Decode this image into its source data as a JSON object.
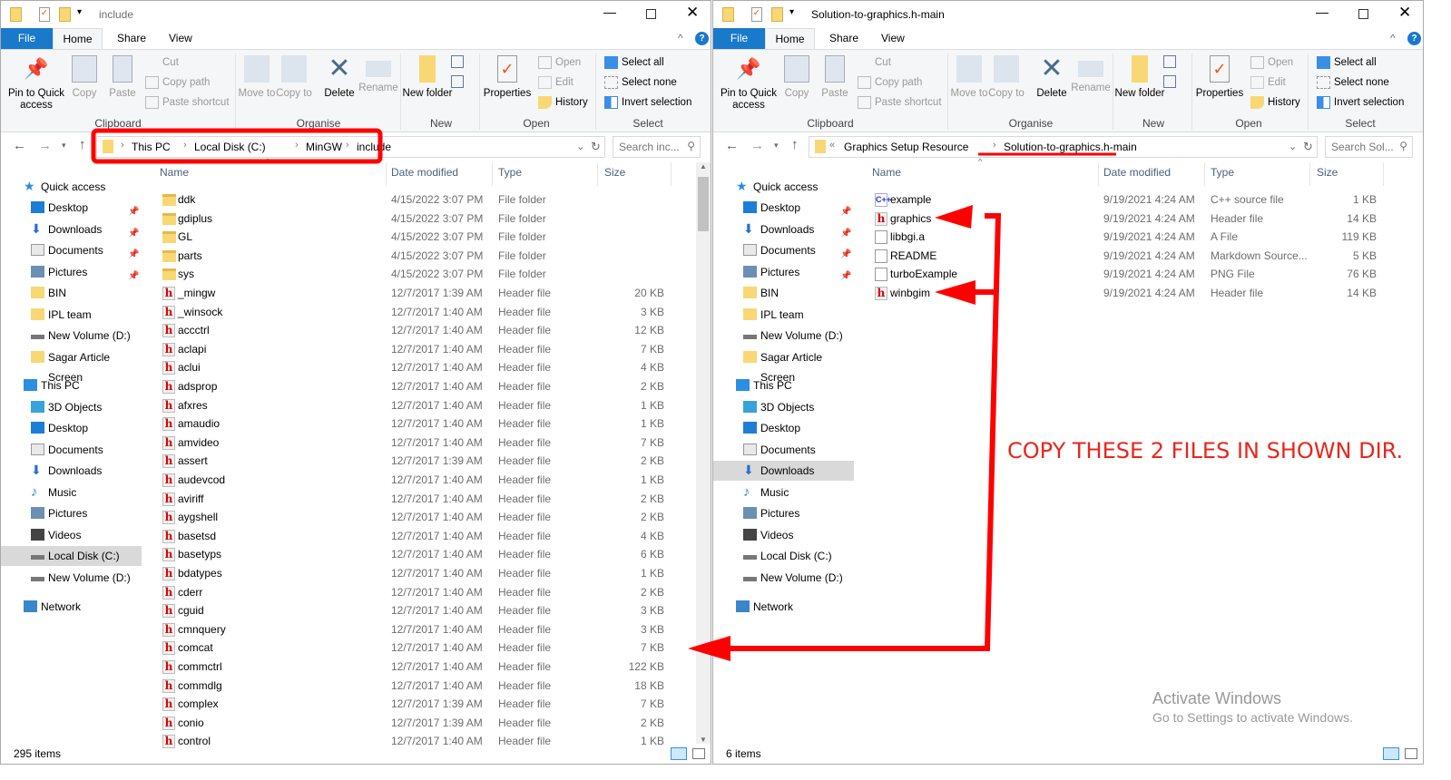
{
  "ribbon": {
    "tabs": {
      "file": "File",
      "home": "Home",
      "share": "Share",
      "view": "View"
    },
    "pin": "Pin to Quick access",
    "copy": "Copy",
    "paste": "Paste",
    "cut": "Cut",
    "copy_path": "Copy path",
    "paste_shortcut": "Paste shortcut",
    "clipboard": "Clipboard",
    "move_to": "Move to",
    "copy_to": "Copy to",
    "delete": "Delete",
    "rename": "Rename",
    "organise": "Organise",
    "new_folder": "New folder",
    "new": "New",
    "properties": "Properties",
    "open": "Open",
    "edit": "Edit",
    "history": "History",
    "open_group": "Open",
    "select_all": "Select all",
    "select_none": "Select none",
    "invert_selection": "Invert selection",
    "select": "Select"
  },
  "columns": {
    "name": "Name",
    "date": "Date modified",
    "type": "Type",
    "size": "Size"
  },
  "left": {
    "title": "include",
    "breadcrumb": [
      "This PC",
      "Local Disk (C:)",
      "MinGW",
      "include"
    ],
    "search_placeholder": "Search inc...",
    "status": "295 items",
    "nav": [
      {
        "label": "Quick access",
        "icon": "star",
        "top": true
      },
      {
        "label": "Desktop",
        "icon": "desktop",
        "pin": true
      },
      {
        "label": "Downloads",
        "icon": "download",
        "pin": true
      },
      {
        "label": "Documents",
        "icon": "document",
        "pin": true
      },
      {
        "label": "Pictures",
        "icon": "pictures",
        "pin": true
      },
      {
        "label": "BIN",
        "icon": "folder"
      },
      {
        "label": "IPL team",
        "icon": "folder"
      },
      {
        "label": "New Volume (D:)",
        "icon": "drive"
      },
      {
        "label": "Sagar Article Screen",
        "icon": "folder"
      },
      {
        "label": "This PC",
        "icon": "pc",
        "top": true
      },
      {
        "label": "3D Objects",
        "icon": "cube"
      },
      {
        "label": "Desktop",
        "icon": "desktop"
      },
      {
        "label": "Documents",
        "icon": "document"
      },
      {
        "label": "Downloads",
        "icon": "download"
      },
      {
        "label": "Music",
        "icon": "music"
      },
      {
        "label": "Pictures",
        "icon": "pictures"
      },
      {
        "label": "Videos",
        "icon": "videos"
      },
      {
        "label": "Local Disk (C:)",
        "icon": "drive",
        "selected": true
      },
      {
        "label": "New Volume (D:)",
        "icon": "drive"
      },
      {
        "label": "Network",
        "icon": "network",
        "top": true
      }
    ],
    "files": [
      {
        "name": "ddk",
        "date": "4/15/2022 3:07 PM",
        "type": "File folder",
        "size": "",
        "icon": "folder"
      },
      {
        "name": "gdiplus",
        "date": "4/15/2022 3:07 PM",
        "type": "File folder",
        "size": "",
        "icon": "folder"
      },
      {
        "name": "GL",
        "date": "4/15/2022 3:07 PM",
        "type": "File folder",
        "size": "",
        "icon": "folder"
      },
      {
        "name": "parts",
        "date": "4/15/2022 3:07 PM",
        "type": "File folder",
        "size": "",
        "icon": "folder"
      },
      {
        "name": "sys",
        "date": "4/15/2022 3:07 PM",
        "type": "File folder",
        "size": "",
        "icon": "folder"
      },
      {
        "name": "_mingw",
        "date": "12/7/2017 1:39 AM",
        "type": "Header file",
        "size": "20 KB",
        "icon": "h"
      },
      {
        "name": "_winsock",
        "date": "12/7/2017 1:40 AM",
        "type": "Header file",
        "size": "3 KB",
        "icon": "h"
      },
      {
        "name": "accctrl",
        "date": "12/7/2017 1:40 AM",
        "type": "Header file",
        "size": "12 KB",
        "icon": "h"
      },
      {
        "name": "aclapi",
        "date": "12/7/2017 1:40 AM",
        "type": "Header file",
        "size": "7 KB",
        "icon": "h"
      },
      {
        "name": "aclui",
        "date": "12/7/2017 1:40 AM",
        "type": "Header file",
        "size": "4 KB",
        "icon": "h"
      },
      {
        "name": "adsprop",
        "date": "12/7/2017 1:40 AM",
        "type": "Header file",
        "size": "2 KB",
        "icon": "h"
      },
      {
        "name": "afxres",
        "date": "12/7/2017 1:40 AM",
        "type": "Header file",
        "size": "1 KB",
        "icon": "h"
      },
      {
        "name": "amaudio",
        "date": "12/7/2017 1:40 AM",
        "type": "Header file",
        "size": "1 KB",
        "icon": "h"
      },
      {
        "name": "amvideo",
        "date": "12/7/2017 1:40 AM",
        "type": "Header file",
        "size": "7 KB",
        "icon": "h"
      },
      {
        "name": "assert",
        "date": "12/7/2017 1:39 AM",
        "type": "Header file",
        "size": "2 KB",
        "icon": "h"
      },
      {
        "name": "audevcod",
        "date": "12/7/2017 1:40 AM",
        "type": "Header file",
        "size": "1 KB",
        "icon": "h"
      },
      {
        "name": "aviriff",
        "date": "12/7/2017 1:40 AM",
        "type": "Header file",
        "size": "2 KB",
        "icon": "h"
      },
      {
        "name": "aygshell",
        "date": "12/7/2017 1:40 AM",
        "type": "Header file",
        "size": "2 KB",
        "icon": "h"
      },
      {
        "name": "basetsd",
        "date": "12/7/2017 1:40 AM",
        "type": "Header file",
        "size": "4 KB",
        "icon": "h"
      },
      {
        "name": "basetyps",
        "date": "12/7/2017 1:40 AM",
        "type": "Header file",
        "size": "6 KB",
        "icon": "h"
      },
      {
        "name": "bdatypes",
        "date": "12/7/2017 1:40 AM",
        "type": "Header file",
        "size": "1 KB",
        "icon": "h"
      },
      {
        "name": "cderr",
        "date": "12/7/2017 1:40 AM",
        "type": "Header file",
        "size": "2 KB",
        "icon": "h"
      },
      {
        "name": "cguid",
        "date": "12/7/2017 1:40 AM",
        "type": "Header file",
        "size": "3 KB",
        "icon": "h"
      },
      {
        "name": "cmnquery",
        "date": "12/7/2017 1:40 AM",
        "type": "Header file",
        "size": "3 KB",
        "icon": "h"
      },
      {
        "name": "comcat",
        "date": "12/7/2017 1:40 AM",
        "type": "Header file",
        "size": "7 KB",
        "icon": "h"
      },
      {
        "name": "commctrl",
        "date": "12/7/2017 1:40 AM",
        "type": "Header file",
        "size": "122 KB",
        "icon": "h"
      },
      {
        "name": "commdlg",
        "date": "12/7/2017 1:40 AM",
        "type": "Header file",
        "size": "18 KB",
        "icon": "h"
      },
      {
        "name": "complex",
        "date": "12/7/2017 1:39 AM",
        "type": "Header file",
        "size": "7 KB",
        "icon": "h"
      },
      {
        "name": "conio",
        "date": "12/7/2017 1:39 AM",
        "type": "Header file",
        "size": "2 KB",
        "icon": "h"
      },
      {
        "name": "control",
        "date": "12/7/2017 1:40 AM",
        "type": "Header file",
        "size": "1 KB",
        "icon": "h"
      }
    ]
  },
  "right": {
    "title": "Solution-to-graphics.h-main",
    "breadcrumb": [
      "Graphics Setup Resource",
      "Solution-to-graphics.h-main"
    ],
    "search_placeholder": "Search Sol...",
    "status": "6 items",
    "nav": [
      {
        "label": "Quick access",
        "icon": "star",
        "top": true
      },
      {
        "label": "Desktop",
        "icon": "desktop",
        "pin": true
      },
      {
        "label": "Downloads",
        "icon": "download",
        "pin": true
      },
      {
        "label": "Documents",
        "icon": "document",
        "pin": true
      },
      {
        "label": "Pictures",
        "icon": "pictures",
        "pin": true
      },
      {
        "label": "BIN",
        "icon": "folder"
      },
      {
        "label": "IPL team",
        "icon": "folder"
      },
      {
        "label": "New Volume (D:)",
        "icon": "drive"
      },
      {
        "label": "Sagar Article Screen",
        "icon": "folder"
      },
      {
        "label": "This PC",
        "icon": "pc",
        "top": true
      },
      {
        "label": "3D Objects",
        "icon": "cube"
      },
      {
        "label": "Desktop",
        "icon": "desktop"
      },
      {
        "label": "Documents",
        "icon": "document"
      },
      {
        "label": "Downloads",
        "icon": "download",
        "selected": true
      },
      {
        "label": "Music",
        "icon": "music"
      },
      {
        "label": "Pictures",
        "icon": "pictures"
      },
      {
        "label": "Videos",
        "icon": "videos"
      },
      {
        "label": "Local Disk (C:)",
        "icon": "drive"
      },
      {
        "label": "New Volume (D:)",
        "icon": "drive"
      },
      {
        "label": "Network",
        "icon": "network",
        "top": true
      }
    ],
    "files": [
      {
        "name": "example",
        "date": "9/19/2021 4:24 AM",
        "type": "C++ source file",
        "size": "1 KB",
        "icon": "cpp"
      },
      {
        "name": "graphics",
        "date": "9/19/2021 4:24 AM",
        "type": "Header file",
        "size": "14 KB",
        "icon": "h"
      },
      {
        "name": "libbgi.a",
        "date": "9/19/2021 4:24 AM",
        "type": "A File",
        "size": "119 KB",
        "icon": "plain"
      },
      {
        "name": "README",
        "date": "9/19/2021 4:24 AM",
        "type": "Markdown Source...",
        "size": "5 KB",
        "icon": "md"
      },
      {
        "name": "turboExample",
        "date": "9/19/2021 4:24 AM",
        "type": "PNG File",
        "size": "76 KB",
        "icon": "png"
      },
      {
        "name": "winbgim",
        "date": "9/19/2021 4:24 AM",
        "type": "Header file",
        "size": "14 KB",
        "icon": "h"
      }
    ]
  },
  "annotation": {
    "text": "COPY THESE 2 FILES IN SHOWN DIR.",
    "color": "#e8261c"
  },
  "watermark": {
    "title": "Activate Windows",
    "subtitle": "Go to Settings to activate Windows."
  }
}
